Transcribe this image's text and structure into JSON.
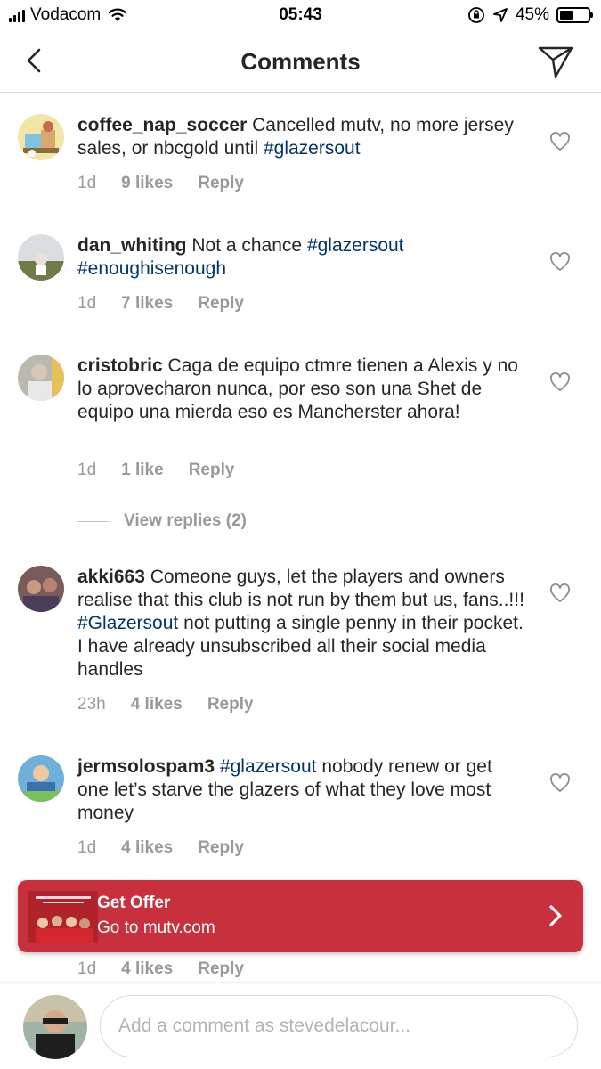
{
  "status_bar": {
    "carrier": "Vodacom",
    "time": "05:43",
    "battery_percent": "45%",
    "battery_level": 0.45,
    "icons": [
      "signal-icon",
      "wifi-icon",
      "orientation-lock-icon",
      "location-icon",
      "battery-icon"
    ]
  },
  "nav": {
    "title": "Comments",
    "back_icon": "chevron-left-icon",
    "send_icon": "paper-plane-icon"
  },
  "comments": [
    {
      "username": "coffee_nap_soccer",
      "text": "Cancelled mutv, no more jersey sales, or nbcgold until",
      "hashtags": "#glazersout",
      "time": "1d",
      "likes": "9 likes",
      "reply": "Reply"
    },
    {
      "username": "dan_whiting",
      "text": "Not a chance",
      "hashtags": "#glazersout #enoughisenough",
      "time": "1d",
      "likes": "7 likes",
      "reply": "Reply"
    },
    {
      "username": "cristobric",
      "text": "Caga de equipo ctmre tienen a Alexis y no lo aprovecharon nunca, por eso son una Shet de equipo una mierda eso es Mancherster ahora!",
      "time": "1d",
      "likes": "1 like",
      "reply": "Reply",
      "view_replies": "View replies (2)"
    },
    {
      "username": "akki663",
      "text_before": "Comeone guys, let the players and owners realise that this club is not run by them but us, fans..!!!",
      "hashtags": "#Glazersout",
      "text_after": "not putting a single penny in their pocket. I have already unsubscribed all their social media handles",
      "time": "23h",
      "likes": "4 likes",
      "reply": "Reply"
    },
    {
      "username": "jermsolospam3",
      "hashtags": "#glazersout",
      "text": "nobody renew or get one let’s starve the glazers of what they love most money",
      "time": "1d",
      "likes": "4 likes",
      "reply": "Reply"
    },
    {
      "time": "1d",
      "likes": "4 likes",
      "reply": "Reply"
    }
  ],
  "ad": {
    "title": "Get Offer",
    "subtitle": "Go to mutv.com",
    "chevron_icon": "chevron-right-icon"
  },
  "composer": {
    "placeholder": "Add a comment as stevedelacour..."
  },
  "colors": {
    "hashtag": "#003569",
    "meta": "#999999",
    "ad_background": "#c8303e",
    "divider": "#dbdbdb"
  }
}
